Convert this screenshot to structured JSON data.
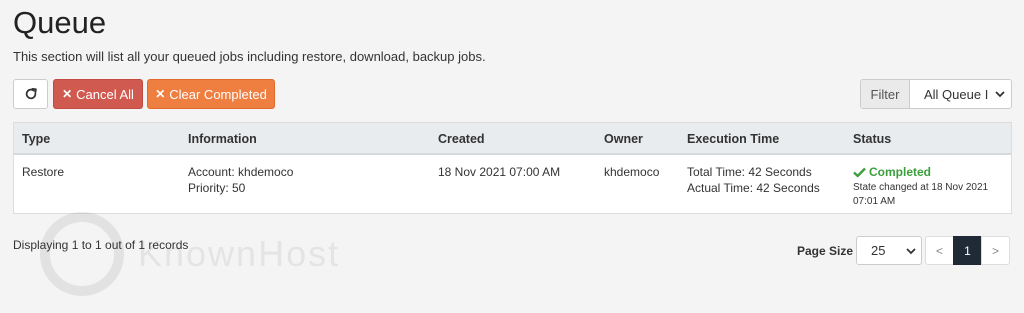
{
  "header": {
    "title": "Queue",
    "description": "This section will list all your queued jobs including restore, download, backup jobs."
  },
  "toolbar": {
    "refresh_icon": "refresh-icon",
    "cancel_all_label": "Cancel All",
    "clear_completed_label": "Clear Completed",
    "filter_label": "Filter",
    "filter_value": "All Queue I"
  },
  "table": {
    "columns": [
      "Type",
      "Information",
      "Created",
      "Owner",
      "Execution Time",
      "Status"
    ],
    "rows": [
      {
        "type": "Restore",
        "info_account": "Account: khdemoco",
        "info_priority": "Priority: 50",
        "created": "18 Nov 2021 07:00 AM",
        "owner": "khdemoco",
        "exec_total": "Total Time: 42 Seconds",
        "exec_actual": "Actual Time: 42 Seconds",
        "status": "Completed",
        "status_note": "State changed at 18 Nov 2021 07:01 AM"
      }
    ]
  },
  "footer": {
    "records_text": "Displaying 1 to 1 out of 1 records",
    "page_size_label": "Page Size",
    "page_size_value": "25",
    "pager": {
      "prev": "<",
      "current": "1",
      "next": ">"
    }
  },
  "watermark": {
    "text": "KnownHost"
  },
  "colors": {
    "danger": "#d05a50",
    "warning": "#ef7e41",
    "success": "#3c9f3c",
    "pager_active": "#1f2a36"
  }
}
